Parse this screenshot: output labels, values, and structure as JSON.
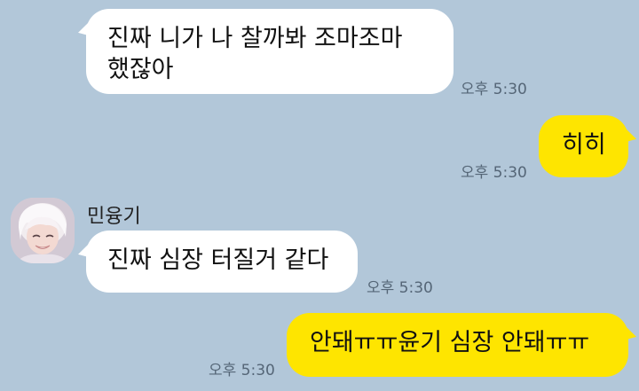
{
  "chat": {
    "messages": [
      {
        "direction": "incoming",
        "text": "진짜 니가 나 찰까봐 조마조마\n했잖아",
        "time": "오후 5:30"
      },
      {
        "direction": "outgoing",
        "text": "히히",
        "time": "오후 5:30"
      },
      {
        "direction": "incoming",
        "sender": "민융기",
        "text": "진짜 심장 터질거 같다",
        "time": "오후 5:30"
      },
      {
        "direction": "outgoing",
        "text": "안돼ㅠㅠ윤기 심장 안돼ㅠㅠ",
        "time": "오후 5:30"
      }
    ]
  },
  "colors": {
    "background": "#b2c7d9",
    "incoming_bubble": "#ffffff",
    "outgoing_bubble": "#fee500",
    "timestamp": "#556677"
  },
  "icons": {
    "avatar": "profile-photo"
  }
}
